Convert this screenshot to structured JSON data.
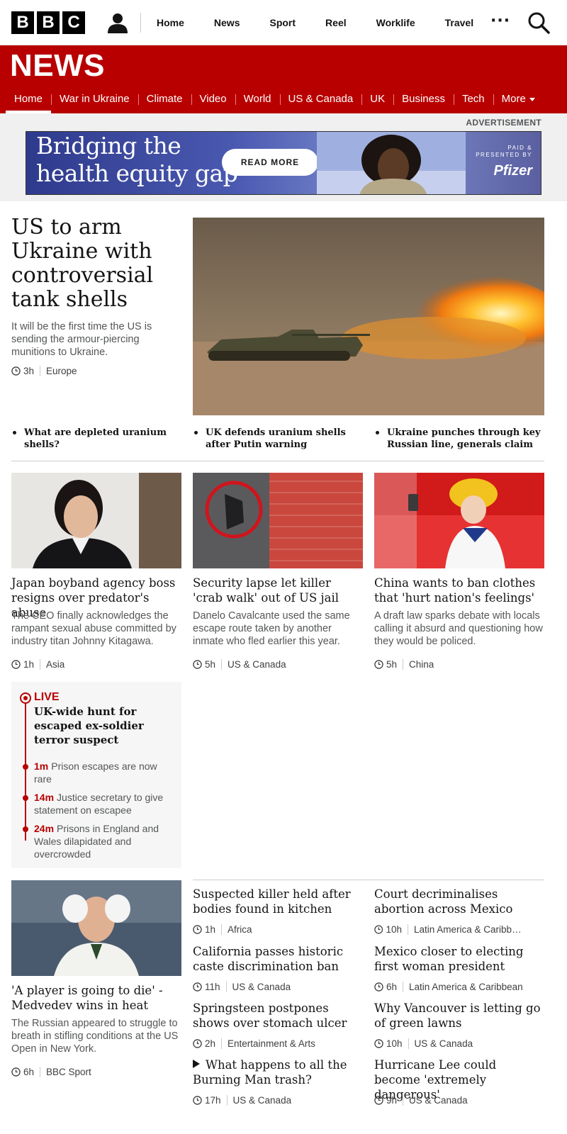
{
  "topbar": {
    "logo_letters": [
      "B",
      "B",
      "C"
    ],
    "account_icon": "account-icon",
    "nav": [
      "Home",
      "News",
      "Sport",
      "Reel",
      "Worklife",
      "Travel"
    ],
    "more_label": "···",
    "search_icon": "search-icon"
  },
  "news_header": {
    "title": "NEWS",
    "nav": [
      "Home",
      "War in Ukraine",
      "Climate",
      "Video",
      "World",
      "US & Canada",
      "UK",
      "Business",
      "Tech",
      "More"
    ],
    "active": "Home"
  },
  "ad": {
    "label": "ADVERTISEMENT",
    "headline_line1": "Bridging the",
    "headline_line2": "health equity gap",
    "button": "READ MORE",
    "presented_line1": "PAID &",
    "presented_line2": "PRESENTED BY",
    "brand": "Pfizer"
  },
  "lead": {
    "headline": "US to arm Ukraine with controversial tank shells",
    "summary": "It will be the first time the US is sending the armour-piercing munitions to Ukraine.",
    "time": "3h",
    "topic": "Europe",
    "related": [
      "What are depleted uranium shells?",
      "UK defends uranium shells after Putin warning",
      "Ukraine punches through key Russian line, generals claim"
    ]
  },
  "cards": [
    {
      "title": "Japan boyband agency boss resigns over predator's abuse",
      "summary": "The CEO finally acknowledges the rampant sexual abuse committed by industry titan Johnny Kitagawa.",
      "time": "1h",
      "topic": "Asia"
    },
    {
      "title": "Security lapse let killer 'crab walk' out of US jail",
      "summary": "Danelo Cavalcante used the same escape route taken by another inmate who fled earlier this year.",
      "time": "5h",
      "topic": "US & Canada"
    },
    {
      "title": "China wants to ban clothes that 'hurt nation's feelings'",
      "summary": "A draft law sparks debate with locals calling it absurd and questioning how they would be policed.",
      "time": "5h",
      "topic": "China"
    }
  ],
  "live": {
    "label": "LIVE",
    "title": "UK-wide hunt for escaped ex-soldier terror suspect",
    "updates": [
      {
        "time": "1m",
        "text": "Prison escapes are now rare"
      },
      {
        "time": "14m",
        "text": "Justice secretary to give statement on escapee"
      },
      {
        "time": "24m",
        "text": "Prisons in England and Wales dilapidated and overcrowded"
      }
    ]
  },
  "sport_card": {
    "title": "'A player is going to die' - Medvedev wins in heat",
    "summary": "The Russian appeared to struggle to breath in stifling conditions at the US Open in New York.",
    "time": "6h",
    "topic": "BBC Sport"
  },
  "list_middle": [
    {
      "title": "Suspected killer held after bodies found in kitchen",
      "time": "1h",
      "topic": "Africa"
    },
    {
      "title": "California passes historic caste discrimination ban",
      "time": "11h",
      "topic": "US & Canada"
    },
    {
      "title": "Springsteen postpones shows over stomach ulcer",
      "time": "2h",
      "topic": "Entertainment & Arts"
    },
    {
      "title": "What happens to all the Burning Man trash?",
      "time": "17h",
      "topic": "US & Canada",
      "video": true
    }
  ],
  "list_right": [
    {
      "title": "Court decriminalises abortion across Mexico",
      "time": "10h",
      "topic": "Latin America & Caribbean"
    },
    {
      "title": "Mexico closer to electing first woman president",
      "time": "6h",
      "topic": "Latin America & Caribbean"
    },
    {
      "title": "Why Vancouver is letting go of green lawns",
      "time": "10h",
      "topic": "US & Canada"
    },
    {
      "title": "Hurricane Lee could become 'extremely dangerous'",
      "time": "9h",
      "topic": "US & Canada"
    }
  ]
}
